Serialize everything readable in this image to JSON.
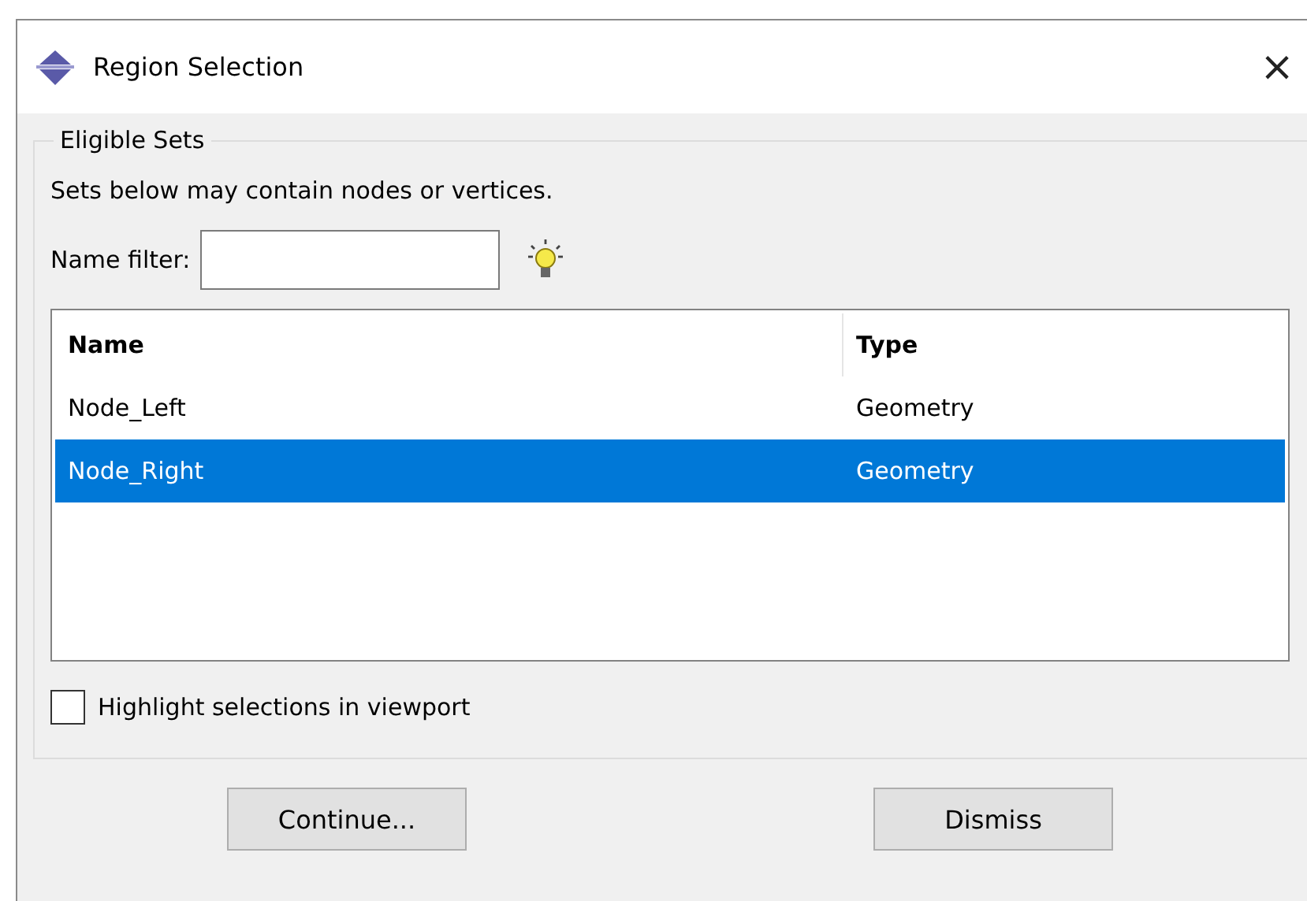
{
  "window": {
    "title": "Region Selection",
    "close": "×"
  },
  "group": {
    "title": "Eligible Sets",
    "description": "Sets below may contain nodes or vertices.",
    "filter": {
      "label": "Name filter:"
    },
    "table": {
      "columns": [
        "Name",
        "Type"
      ],
      "rows": [
        {
          "cells": [
            "Node_Left",
            "Geometry"
          ],
          "selected": false
        },
        {
          "cells": [
            "Node_Right",
            "Geometry"
          ],
          "selected": true
        }
      ]
    },
    "highlight": {
      "label": "Highlight selections in viewport",
      "checked": false
    }
  },
  "buttons": [
    "Continue...",
    "Dismiss"
  ]
}
